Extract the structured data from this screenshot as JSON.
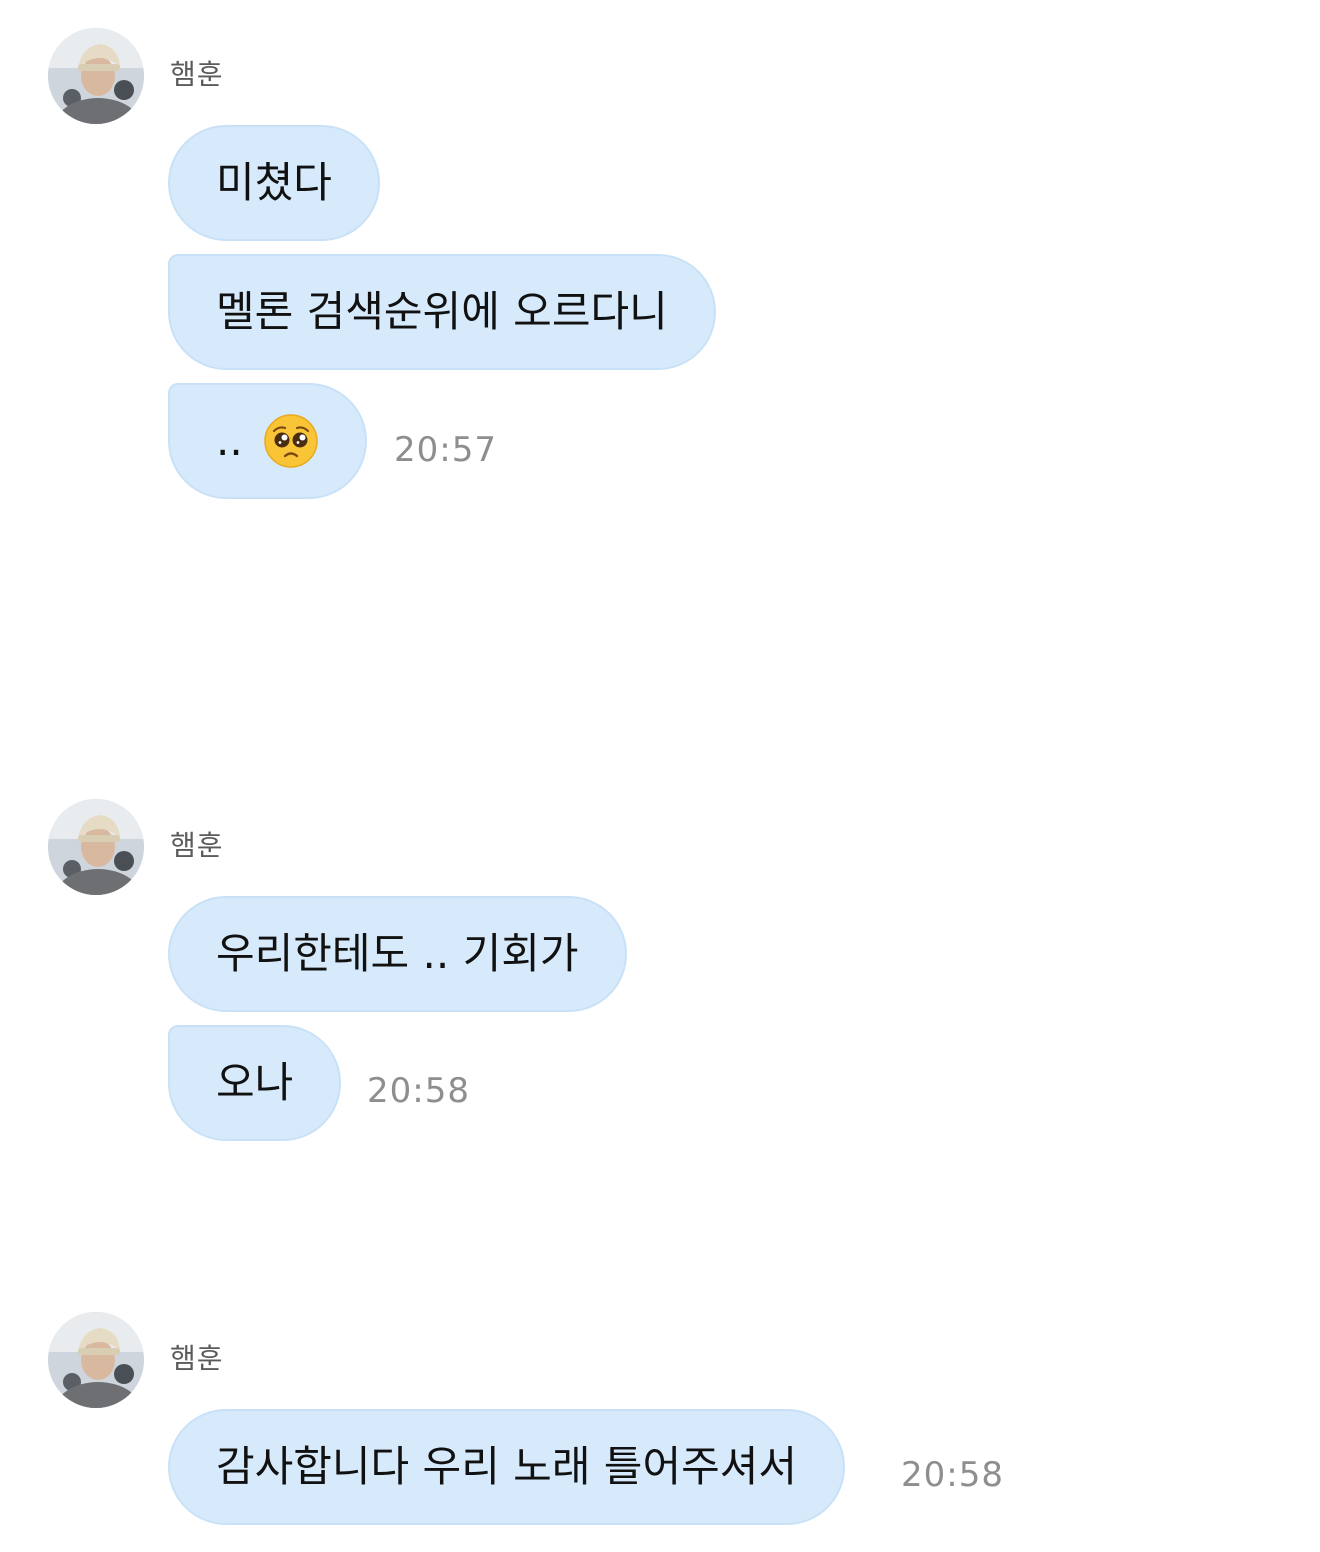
{
  "chat": {
    "groups": [
      {
        "sender": "햄훈",
        "messages": [
          "미쳤다",
          "멜론 검색순위에 오르다니",
          ".."
        ],
        "emoji": "pleading-face-emoji",
        "time": "20:57"
      },
      {
        "sender": "햄훈",
        "messages": [
          "우리한테도 .. 기회가",
          "오나"
        ],
        "time": "20:58"
      },
      {
        "sender": "햄훈",
        "messages": [
          "감사합니다 우리 노래 틀어주셔서"
        ],
        "time": "20:58"
      }
    ]
  },
  "colors": {
    "bubble": "#d6eafc",
    "bubble_border": "#c9e1f7",
    "sender": "#5b5b5b",
    "time": "#8e8e8e",
    "background": "#ffffff"
  }
}
